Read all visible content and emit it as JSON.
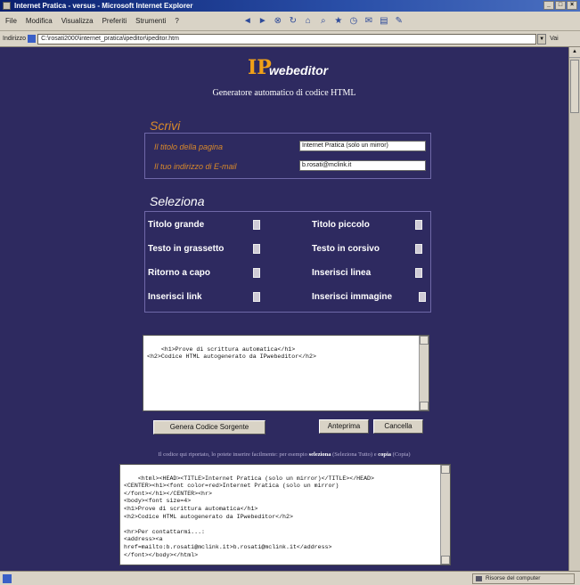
{
  "window": {
    "title": "Internet Pratica - versus - Microsoft Internet Explorer",
    "minimize": "_",
    "maximize": "□",
    "close": "×"
  },
  "menu": {
    "items": [
      "File",
      "Modifica",
      "Visualizza",
      "Preferiti",
      "Strumenti",
      "?"
    ]
  },
  "toolbar": {
    "icons": [
      "back-icon",
      "forward-icon",
      "stop-icon",
      "refresh-icon",
      "home-icon",
      "search-icon",
      "favorites-icon",
      "history-icon",
      "mail-icon",
      "print-icon",
      "edit-icon"
    ]
  },
  "address": {
    "label": "Indirizzo",
    "value": "C:\\rosati2000\\internet_pratica\\ipeditor\\ipeditor.htm",
    "go_label": "Vai"
  },
  "header": {
    "logo_ip": "IP",
    "logo_text": "webeditor",
    "subtitle": "Generatore automatico di codice HTML"
  },
  "scrivi": {
    "title": "Scrivi",
    "title_label": "Il titolo della pagina",
    "title_value": "Internet Pratica (solo un mirror)",
    "email_label": "Il tuo indirizzo di E-mail",
    "email_value": "b.rosati@mclink.it"
  },
  "seleziona": {
    "title": "Seleziona",
    "options": [
      {
        "label": "Titolo grande"
      },
      {
        "label": "Titolo piccolo"
      },
      {
        "label": "Testo in grassetto"
      },
      {
        "label": "Testo in corsivo"
      },
      {
        "label": "Ritorno a capo"
      },
      {
        "label": "Inserisci linea"
      },
      {
        "label": "Inserisci link"
      },
      {
        "label": "Inserisci immagine"
      }
    ]
  },
  "editor": {
    "text": "<h1>Prove di scrittura automatica</h1>\n<h2>Codice HTML autogenerato da IPwebeditor</h2>"
  },
  "buttons": {
    "generate": "Genera Codice Sorgente",
    "preview": "Anteprima",
    "clear": "Cancella"
  },
  "info": {
    "prefix": "Il codice qui riportato, lo potete inserire facilmente: per esempio",
    "select_word": "seleziona",
    "middle": "(Seleziona Tutto) e",
    "copy_word": "copia",
    "suffix": "(Copia)"
  },
  "output": {
    "text": "<html><HEAD><TITLE>Internet Pratica (solo un mirror)</TITLE></HEAD>\n<CENTER><h1><font color=red>Internet Pratica (solo un mirror)\n</font></h1></CENTER><hr>\n<body><font size=4>\n<h1>Prove di scrittura automatica</h1>\n<h2>Codice HTML autogenerato da IPwebeditor</h2>\n\n<hr>Per contattarmi...:\n<address><a\nhref=mailto:b.rosati@mclink.it>b.rosati@mclink.it</address>\n</font></body></html>"
  },
  "status": {
    "zone": "Risorse del computer"
  },
  "colors": {
    "page_background": "#2e2a60",
    "accent_orange": "#d98a2a",
    "logo_orange": "#f0a018"
  }
}
